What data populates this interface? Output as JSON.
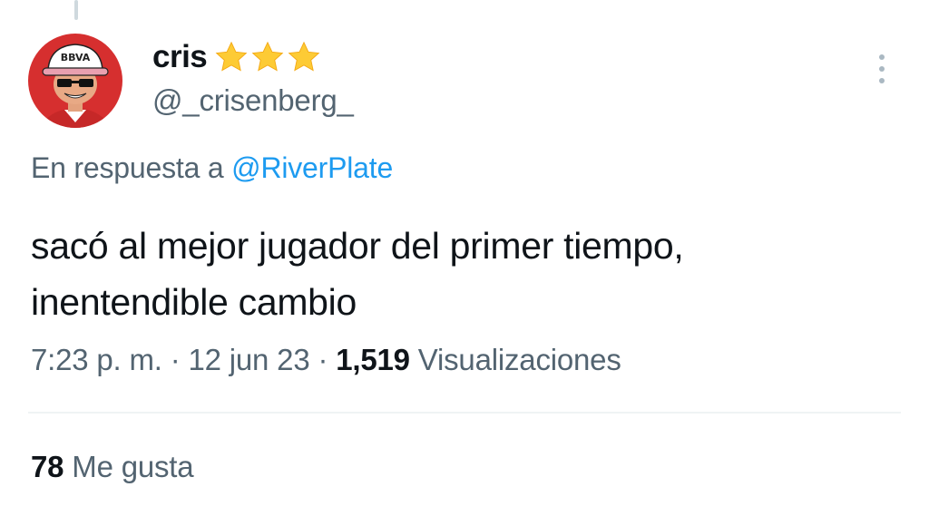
{
  "tweet": {
    "author": {
      "display_name": "cris",
      "handle": "@_crisenberg_",
      "badge_icons": [
        "star-icon",
        "star-icon",
        "star-icon"
      ],
      "avatar_text": "BBVA"
    },
    "reply_to": {
      "prefix": "En respuesta a",
      "handle": "@RiverPlate"
    },
    "text_line_1": "sacó al mejor jugador del primer tiempo,",
    "text_line_2": "inentendible cambio",
    "meta": {
      "time": "7:23 p. m.",
      "separator": "·",
      "date": "12 jun 23",
      "views_count": "1,519",
      "views_label": "Visualizaciones"
    },
    "likes": {
      "count": "78",
      "label": "Me gusta"
    },
    "more_icon": "more-vertical-icon"
  },
  "colors": {
    "text_primary": "#0f1419",
    "text_secondary": "#536471",
    "link": "#1d9bf0",
    "star": "#fdcb35",
    "divider": "#eff3f4",
    "avatar_background": "#d62f2f"
  }
}
